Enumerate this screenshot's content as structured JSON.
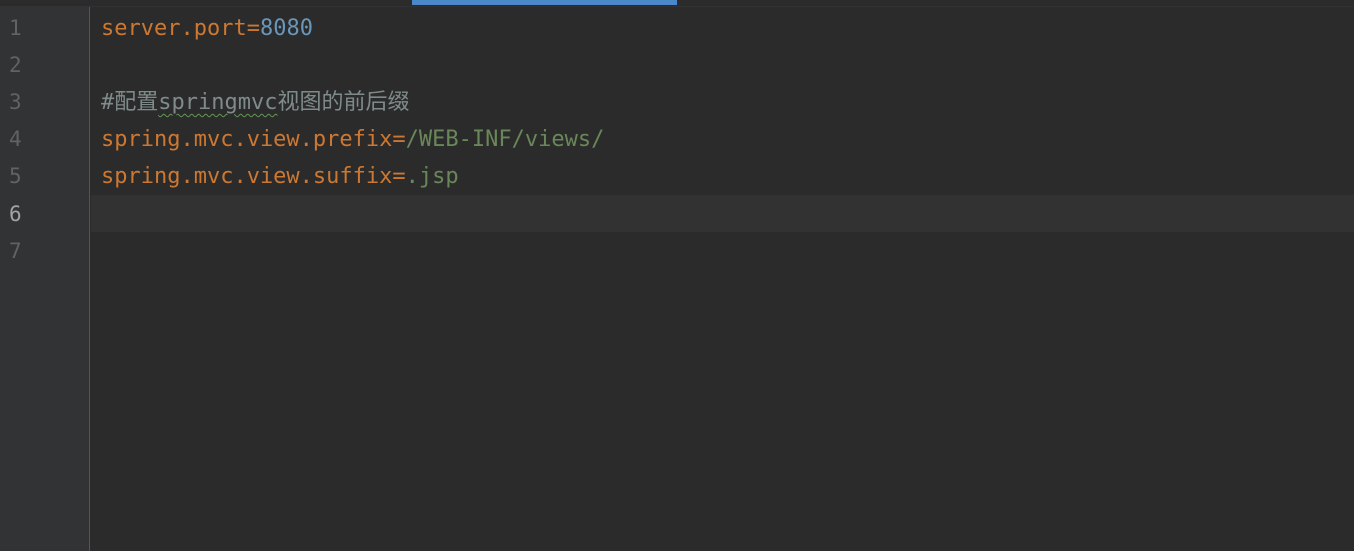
{
  "editor": {
    "line_numbers": [
      "1",
      "2",
      "3",
      "4",
      "5",
      "6",
      "7"
    ],
    "current_line": "6",
    "lines": {
      "l1": {
        "key": "server.port",
        "eq": "=",
        "value": "8080"
      },
      "l3": {
        "hash": "#",
        "pre": "配置",
        "typo": "springmvc",
        "post": "视图的前后缀"
      },
      "l4": {
        "key": "spring.mvc.view.prefix",
        "eq": "=",
        "value": "/WEB-INF/views/"
      },
      "l5": {
        "key": "spring.mvc.view.suffix",
        "eq": "=",
        "value": ".jsp"
      }
    }
  },
  "colors": {
    "background": "#2b2b2b",
    "gutter": "#313335",
    "key": "#cc7832",
    "number": "#6897bb",
    "string_value": "#6a8759",
    "comment": "#7f8b8a",
    "tab_indicator": "#4a88c7"
  }
}
